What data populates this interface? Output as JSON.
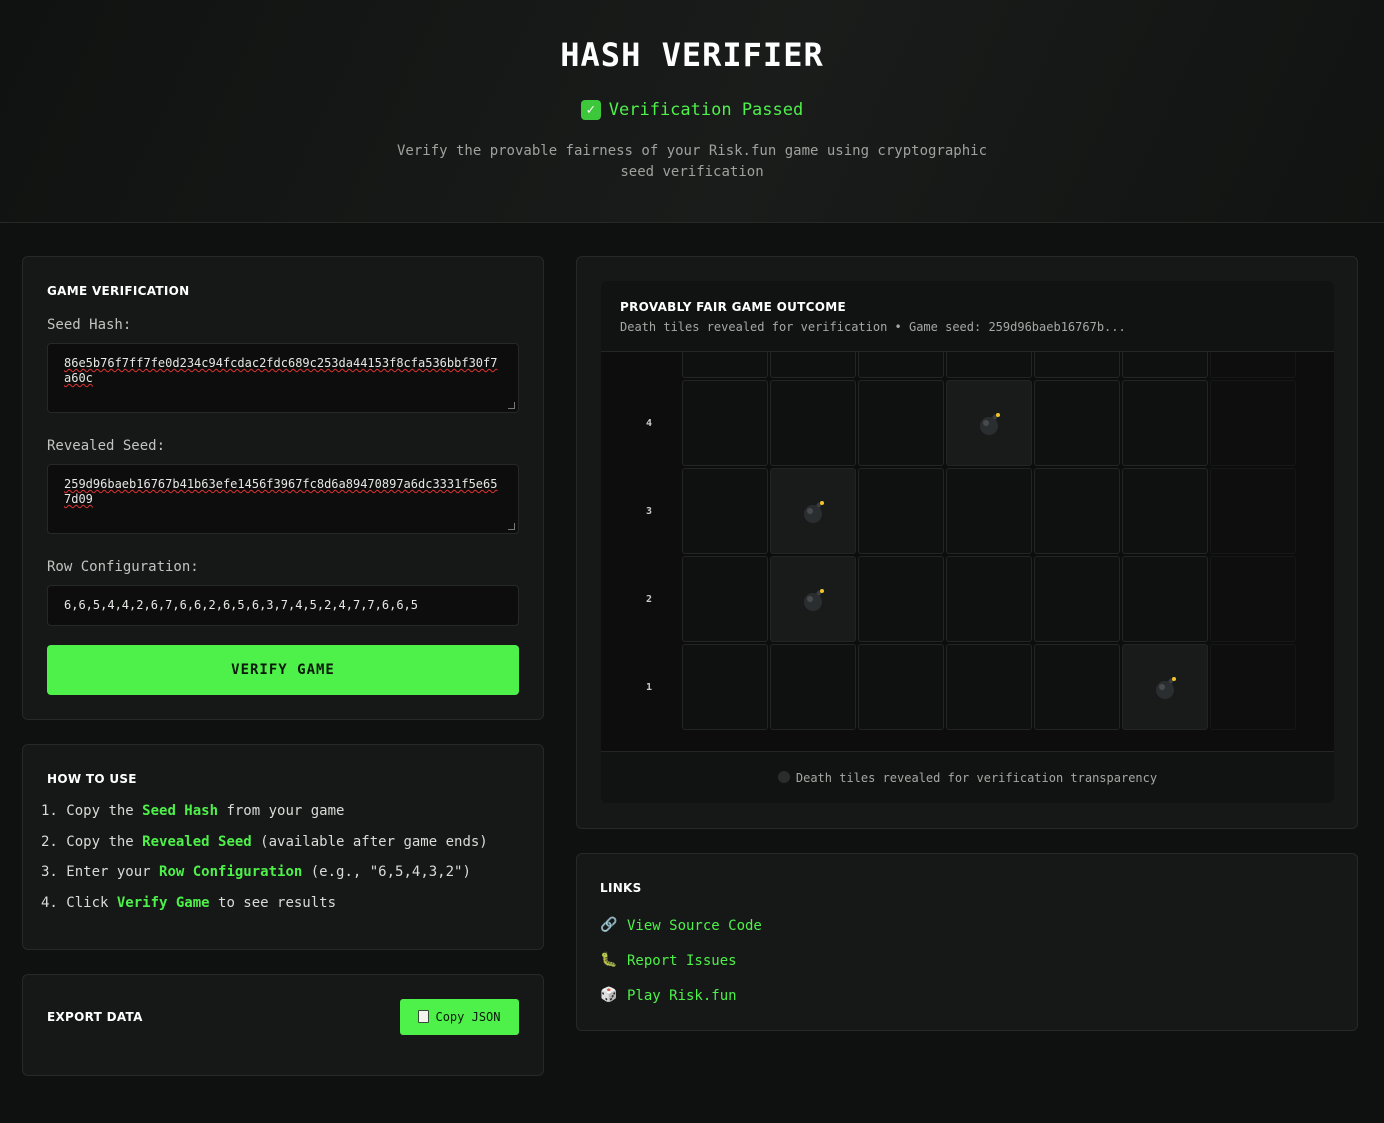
{
  "header": {
    "title": "HASH VERIFIER",
    "status": "Verification Passed",
    "subtitle": "Verify the provable fairness of your Risk.fun game using cryptographic seed verification"
  },
  "verification": {
    "title": "GAME VERIFICATION",
    "seed_hash_label": "Seed Hash:",
    "seed_hash": "86e5b76f7ff7fe0d234c94fcdac2fdc689c253da44153f8cfa536bbf30f7a60c",
    "revealed_seed_label": "Revealed Seed:",
    "revealed_seed": "259d96baeb16767b41b63efe1456f3967fc8d6a89470897a6dc3331f5e657d09",
    "row_config_label": "Row Configuration:",
    "row_config": "6,6,5,4,4,2,6,7,6,6,2,6,5,6,3,7,4,5,2,4,7,7,6,6,5",
    "verify_button": "VERIFY GAME"
  },
  "how_to": {
    "title": "HOW TO USE",
    "steps": [
      {
        "num": "1.",
        "pre": "Copy the ",
        "hl": "Seed Hash",
        "post": " from your game"
      },
      {
        "num": "2.",
        "pre": "Copy the ",
        "hl": "Revealed Seed",
        "post": " (available after game ends)"
      },
      {
        "num": "3.",
        "pre": "Enter your ",
        "hl": "Row Configuration",
        "post": " (e.g., \"6,5,4,3,2\")"
      },
      {
        "num": "4.",
        "pre": "Click ",
        "hl": "Verify Game",
        "post": " to see results"
      }
    ]
  },
  "export": {
    "title": "EXPORT DATA",
    "copy_button": "Copy JSON",
    "copy_icon": "clipboard-icon"
  },
  "outcome": {
    "title": "PROVABLY FAIR GAME OUTCOME",
    "subtitle": "Death tiles revealed for verification • Game seed: 259d96baeb16767b...",
    "row_labels": [
      "4",
      "3",
      "2",
      "1"
    ],
    "death_tiles": [
      {
        "row": 4,
        "col": 4
      },
      {
        "row": 3,
        "col": 2
      },
      {
        "row": 2,
        "col": 2
      },
      {
        "row": 1,
        "col": 6
      }
    ],
    "footer": "Death tiles revealed for verification transparency",
    "bomb_icon": "bomb-icon"
  },
  "links": {
    "title": "LINKS",
    "items": [
      {
        "label": "View Source Code",
        "icon": "link-icon"
      },
      {
        "label": "Report Issues",
        "icon": "bug-icon"
      },
      {
        "label": "Play Risk.fun",
        "icon": "dice-icon"
      }
    ]
  },
  "colors": {
    "accent": "#4ef04a",
    "background": "#0f1110",
    "card": "#161817"
  }
}
